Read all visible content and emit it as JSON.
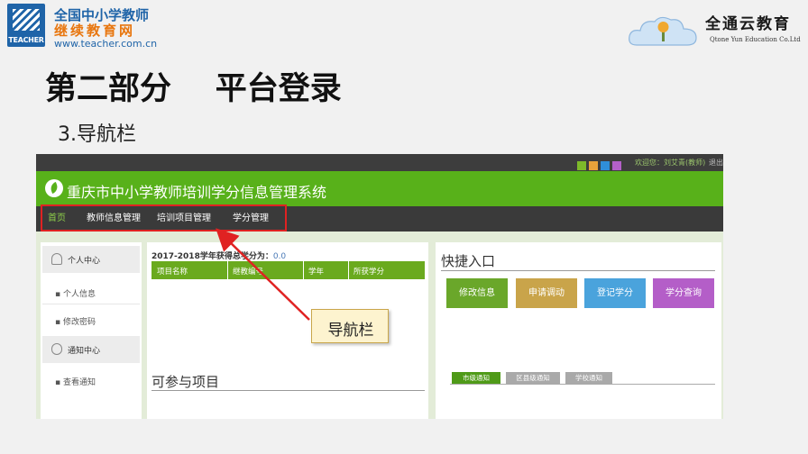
{
  "header": {
    "logo_left": {
      "badge_text": "TEACHER",
      "line1": "全国中小学教师",
      "line2": "继续教育网",
      "url": "www.teacher.com.cn"
    },
    "logo_right": {
      "brand_cn": "全通云教育",
      "brand_en": "Qtone Yun Education Co.Ltd"
    }
  },
  "slide": {
    "title": "第二部分    平台登录",
    "subtitle": "3.导航栏",
    "callout": "导航栏"
  },
  "system": {
    "top_bar": {
      "welcome": "欢迎您：刘艾青(教师)",
      "logout": "退出",
      "color_squares": [
        "#7dba2a",
        "#e8a23a",
        "#2f8fd8",
        "#b460c8"
      ]
    },
    "title": "重庆市中小学教师培训学分信息管理系统",
    "nav": {
      "home": "首页",
      "teacher_info": "教师信息管理",
      "training_projects": "培训项目管理",
      "credit_mgmt": "学分管理"
    },
    "sidebar": {
      "personal_center": "个人中心",
      "personal_info": "个人信息",
      "change_password": "修改密码",
      "notice_center": "通知中心",
      "view_notices": "查看通知"
    },
    "credits": {
      "caption": "2017-2018学年获得总学分为：",
      "value": "0.0",
      "columns": [
        "项目名称",
        "继教编号",
        "学年",
        "所获学分"
      ],
      "rows": []
    },
    "available_projects": "可参与项目",
    "quick_access": {
      "title": "快捷入口",
      "buttons": [
        {
          "label": "修改信息",
          "color": "#6aa72a"
        },
        {
          "label": "申请调动",
          "color": "#c9a44a"
        },
        {
          "label": "登记学分",
          "color": "#4aa3dc"
        },
        {
          "label": "学分查询",
          "color": "#b45ec8"
        }
      ]
    },
    "notice_tabs": [
      "市级通知",
      "区县级通知",
      "学校通知"
    ]
  },
  "colors": {
    "banner_green": "#58b11a",
    "nav_dark": "#3a3a3a",
    "highlight_red": "#e02222"
  }
}
